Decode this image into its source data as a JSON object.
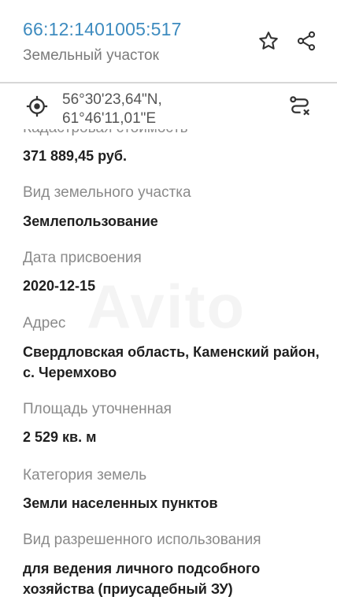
{
  "header": {
    "cadastral_number": "66:12:1401005:517",
    "object_type": "Земельный участок",
    "icons": [
      "star-icon",
      "share-icon"
    ]
  },
  "coordinates": {
    "latitude": "56°30'23,64\"N,",
    "longitude": "61°46'11,01\"E",
    "icons": [
      "target-icon",
      "route-icon"
    ]
  },
  "fields": {
    "partial_label": "Кадастровая стоимость",
    "cadastral_value": "371 889,45 руб.",
    "land_type_label": "Вид земельного участка",
    "land_type_value": "Землепользование",
    "assignment_date_label": "Дата присвоения",
    "assignment_date_value": "2020-12-15",
    "address_label": "Адрес",
    "address_value": "Свердловская область, Каменский район, с. Черемхово",
    "area_label": "Площадь уточненная",
    "area_value": "2 529 кв. м",
    "category_label": "Категория земель",
    "category_value": "Земли населенных пунктов",
    "permitted_use_label": "Вид разрешенного использования",
    "permitted_use_value": "для ведения личного подсобного хозяйства (приусадебный ЗУ)"
  },
  "watermark": "Avito",
  "colors": {
    "accent": "#3d8bbf",
    "label": "#8a8a8a",
    "value": "#1f1f1f",
    "divider": "#d7d7d7"
  }
}
